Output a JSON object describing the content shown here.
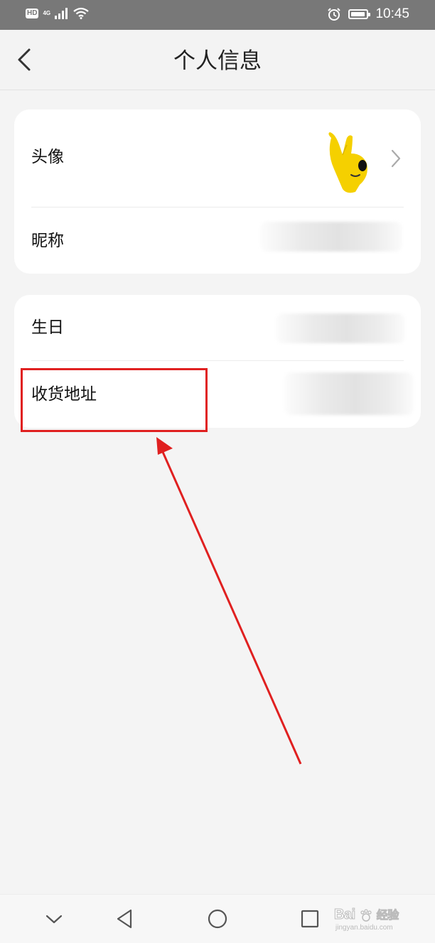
{
  "status_bar": {
    "hd_badge": "HD",
    "network_type": "4G",
    "time": "10:45",
    "battery_level": 0.85
  },
  "header": {
    "title": "个人信息"
  },
  "profile_card": {
    "avatar_label": "头像",
    "nickname_label": "昵称"
  },
  "details_card": {
    "birthday_label": "生日",
    "address_label": "收货地址"
  },
  "watermark": {
    "brand": "Bai",
    "brand_suffix": "经验",
    "site": "jingyan.baidu.com"
  },
  "colors": {
    "status_bar": "#787878",
    "background": "#f4f4f4",
    "card": "#ffffff",
    "annotation_red": "#e02020",
    "avatar_yellow": "#f5d000"
  }
}
